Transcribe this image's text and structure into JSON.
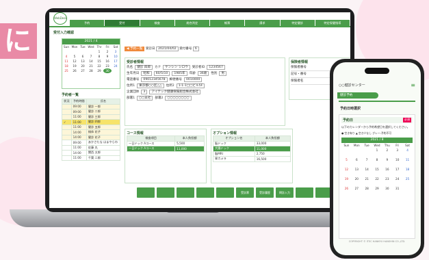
{
  "bg_char": "に",
  "laptop": {
    "logo": "WebDesk",
    "nav": [
      "予約",
      "受付",
      "検査",
      "総合判定",
      "帳票",
      "請求",
      "特定健診",
      "特定保健指導"
    ],
    "page_title": "受付入力確認",
    "calendar": {
      "month": "2021 / 4",
      "dow": [
        "Sun",
        "Mon",
        "Tue",
        "Wed",
        "Thr",
        "Fri",
        "Sat"
      ],
      "days": [
        "",
        "",
        "",
        "",
        "1",
        "2",
        "3",
        "4",
        "5",
        "6",
        "7",
        "8",
        "9",
        "10",
        "11",
        "12",
        "13",
        "14",
        "15",
        "16",
        "17",
        "18",
        "19",
        "20",
        "21",
        "22",
        "23",
        "24",
        "25",
        "26",
        "27",
        "28",
        "29",
        "30",
        ""
      ],
      "selected": "30"
    },
    "reservation_title": "予約者一覧",
    "res_headers": [
      "状況",
      "予約時間",
      "氏名"
    ],
    "res_rows": [
      [
        "",
        "09:00",
        "健診 一郎"
      ],
      [
        "",
        "09:00",
        "健診 二郎"
      ],
      [
        "",
        "11:00",
        "健診 三郎"
      ],
      [
        "✓",
        "11:00",
        "健診 四郎"
      ],
      [
        "",
        "11:00",
        "健診 五郎"
      ],
      [
        "",
        "14:00",
        "検体 花子"
      ],
      [
        "",
        "14:00",
        "健診 花子"
      ],
      [
        "",
        "09:00",
        "あかさたな はまやらわ"
      ],
      [
        "",
        "11:00",
        "佐藤 丸"
      ],
      [
        "",
        "14:00",
        "関西 太郎"
      ],
      [
        "",
        "11:00",
        "千葉 二郎"
      ]
    ],
    "top_fields": {
      "btn": "◀ 予約一覧",
      "date_label": "受診日",
      "date": "2021/04/02",
      "num_label": "受付番号",
      "num": "6"
    },
    "patient_title": "受診者情報",
    "patient": {
      "name_label": "氏名",
      "name": "健診 四郎",
      "kana_label": "カナ",
      "kana": "ケンシン シロウ",
      "id_label": "受診者ID",
      "id": "1234567",
      "dob_label": "生年月日",
      "era": "昭和",
      "dob": "60/5/10",
      "year": "1985年",
      "age_label": "年齢",
      "age": "36歳",
      "sex_label": "性別",
      "sex": "男",
      "tel_label": "電話番号",
      "tel": "09012345678",
      "zip_label": "郵便番号",
      "zip": "0010000",
      "addr1_label": "住所1",
      "addr1": "東京都○○区△△",
      "addr2_label": "住所2",
      "addr2": "1-1-1□□ビル5F",
      "co_label": "企業団体",
      "co_code": "3",
      "co": "アイテック健康保険組合株式会社",
      "dept_label": "部署1",
      "dept": "○○支社",
      "dept2_label": "部署2",
      "dept2": "○○○○○○○○"
    },
    "insurance_title": "保険者情報",
    "insurance_rows": [
      "保険者番号",
      "記号・番号",
      "保険者名"
    ],
    "course_title": "コース情報",
    "course_headers": [
      "検査項目",
      "本人負担額"
    ],
    "course_rows": [
      [
        "一日ドック Aコース",
        "5,500"
      ],
      [
        "一日ドック Aコース",
        "11,000"
      ]
    ],
    "option_title": "オプション情報",
    "option_headers": [
      "オプション名",
      "本人負担額"
    ],
    "option_rows": [
      [
        "脳ドック",
        "33,000"
      ],
      [
        "大腸ドック",
        "11,000"
      ],
      [
        "脳MRI",
        "2,750"
      ],
      [
        "胃カメラ",
        "16,500"
      ]
    ],
    "bottom_buttons": [
      "",
      "",
      "",
      "",
      "",
      "受診票",
      "受診履歴",
      "問診入力",
      "",
      "",
      "続け受付"
    ]
  },
  "phone": {
    "header": "○○健診センター",
    "tab": "健診予約",
    "section": "予約日時選択",
    "card_title": "予約日",
    "badge": "必須",
    "desc": "以下のカレンダーから予約希望日を選択してください。",
    "legend": "● 空き有り ▲ 空き少なし グレー:予約不可",
    "cal_month": "2021 / 8",
    "dow": [
      "Sun",
      "Mon",
      "Tue",
      "Wed",
      "Thu",
      "Fri",
      "Sat"
    ],
    "days": [
      "",
      "",
      "",
      "1",
      "2",
      "3",
      "4",
      "5",
      "6",
      "7",
      "8",
      "9",
      "10",
      "11",
      "12",
      "13",
      "14",
      "15",
      "16",
      "17",
      "18",
      "19",
      "20",
      "21",
      "22",
      "23",
      "24",
      "25",
      "26",
      "27",
      "28",
      "29",
      "30",
      "31",
      ""
    ],
    "copyright": "COPYRIGHT © ITEC HANKYU HANSHIN CO.,LTD."
  }
}
